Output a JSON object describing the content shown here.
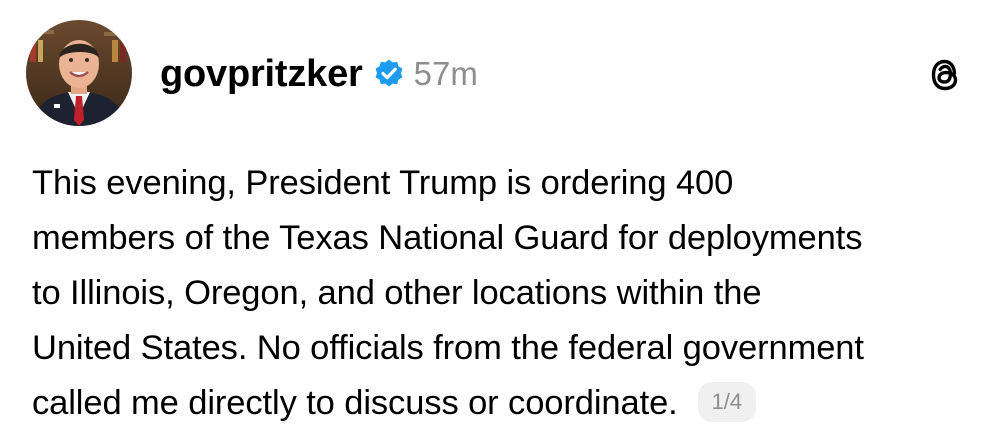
{
  "author": {
    "username": "govpritzker",
    "verified": true,
    "verified_badge_color": "#1d9bf0",
    "timestamp": "57m"
  },
  "app": {
    "logo_icon": "threads-logo-icon"
  },
  "post": {
    "lines": [
      "This evening, President Trump is ordering 400",
      "members of the Texas National Guard for deployments",
      "to Illinois, Oregon, and other locations within the",
      "United States. No officials from the federal government",
      "called me directly to discuss or coordinate."
    ],
    "page_indicator": "1/4"
  },
  "colors": {
    "text": "#000000",
    "secondary_text": "#8e8e8e",
    "background": "#ffffff"
  }
}
